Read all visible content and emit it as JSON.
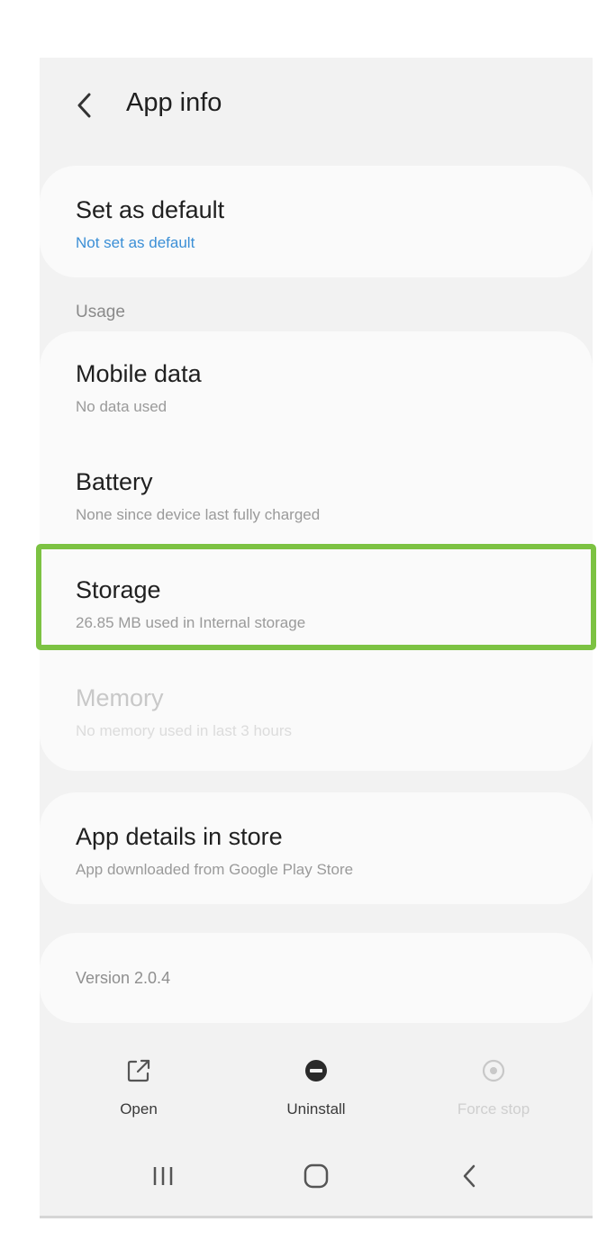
{
  "header": {
    "title": "App info"
  },
  "default_card": {
    "title": "Set as default",
    "subtitle": "Not set as default"
  },
  "usage": {
    "section_label": "Usage",
    "items": [
      {
        "title": "Mobile data",
        "subtitle": "No data used"
      },
      {
        "title": "Battery",
        "subtitle": "None since device last fully charged"
      },
      {
        "title": "Storage",
        "subtitle": "26.85 MB used in Internal storage"
      },
      {
        "title": "Memory",
        "subtitle": "No memory used in last 3 hours"
      }
    ]
  },
  "store_card": {
    "title": "App details in store",
    "subtitle": "App downloaded from Google Play Store"
  },
  "version_card": {
    "text": "Version 2.0.4"
  },
  "actions": [
    {
      "label": "Open",
      "icon": "open-external-icon"
    },
    {
      "label": "Uninstall",
      "icon": "uninstall-icon"
    },
    {
      "label": "Force stop",
      "icon": "force-stop-icon"
    }
  ],
  "nav": {
    "recents_icon": "recents-icon",
    "home_icon": "home-icon",
    "back_icon": "back-icon"
  },
  "colors": {
    "accent_link": "#3b8fd6",
    "highlight": "#7cc242",
    "disabled_text": "#c8c8c8"
  }
}
